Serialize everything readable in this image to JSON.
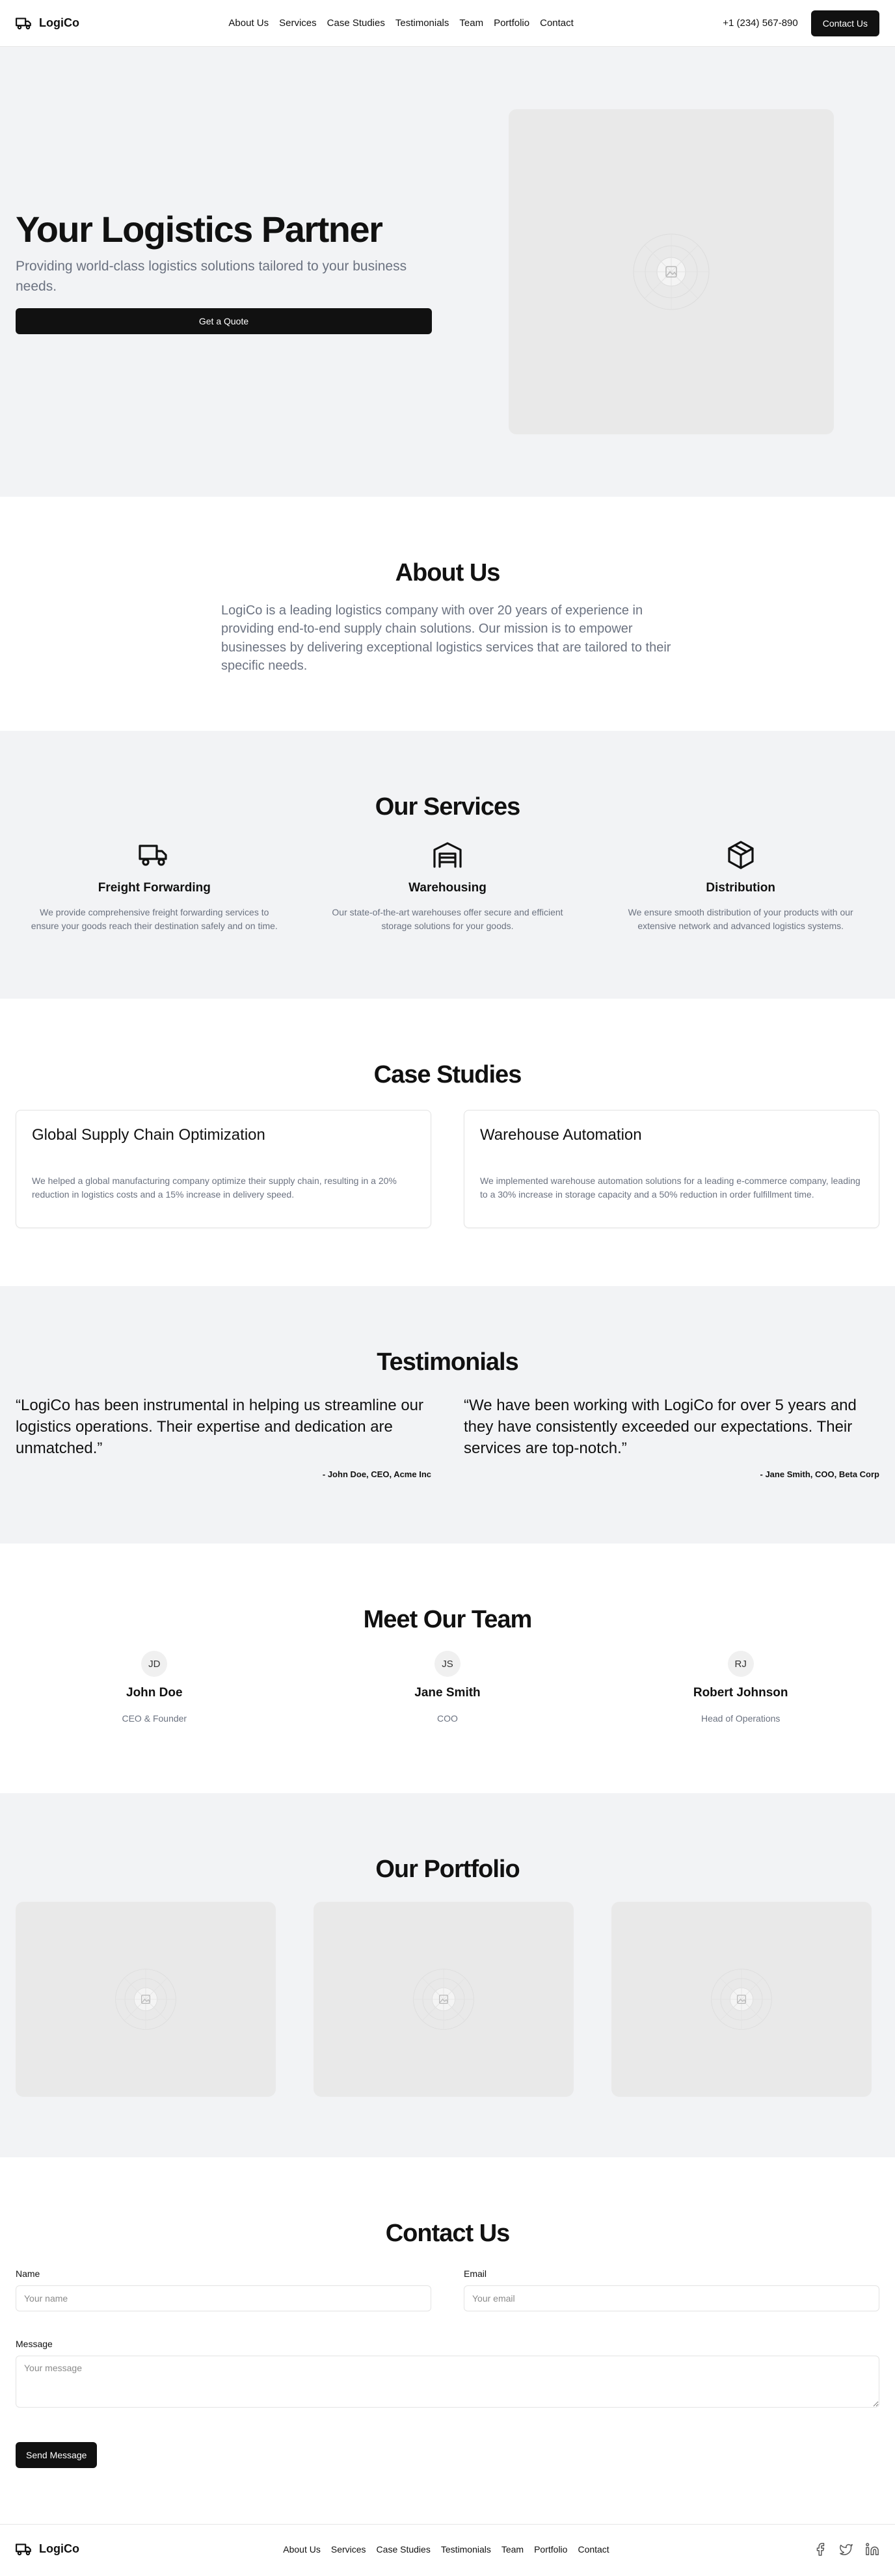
{
  "header": {
    "brand": "LogiCo",
    "nav": [
      "About Us",
      "Services",
      "Case Studies",
      "Testimonials",
      "Team",
      "Portfolio",
      "Contact"
    ],
    "phone": "+1 (234) 567-890",
    "contact_button": "Contact Us"
  },
  "hero": {
    "title": "Your Logistics Partner",
    "subtitle": "Providing world-class logistics solutions tailored to your business needs.",
    "cta": "Get a Quote"
  },
  "about": {
    "title": "About Us",
    "text": "LogiCo is a leading logistics company with over 20 years of experience in providing end-to-end supply chain solutions. Our mission is to empower businesses by delivering exceptional logistics services that are tailored to their specific needs."
  },
  "services": {
    "title": "Our Services",
    "items": [
      {
        "title": "Freight Forwarding",
        "text": "We provide comprehensive freight forwarding services to ensure your goods reach their destination safely and on time.",
        "icon": "truck-icon"
      },
      {
        "title": "Warehousing",
        "text": "Our state-of-the-art warehouses offer secure and efficient storage solutions for your goods.",
        "icon": "warehouse-icon"
      },
      {
        "title": "Distribution",
        "text": "We ensure smooth distribution of your products with our extensive network and advanced logistics systems.",
        "icon": "package-icon"
      }
    ]
  },
  "cases": {
    "title": "Case Studies",
    "items": [
      {
        "title": "Global Supply Chain Optimization",
        "text": "We helped a global manufacturing company optimize their supply chain, resulting in a 20% reduction in logistics costs and a 15% increase in delivery speed."
      },
      {
        "title": "Warehouse Automation",
        "text": "We implemented warehouse automation solutions for a leading e-commerce company, leading to a 30% increase in storage capacity and a 50% reduction in order fulfillment time."
      }
    ]
  },
  "testimonials": {
    "title": "Testimonials",
    "items": [
      {
        "quote": "“LogiCo has been instrumental in helping us streamline our logistics operations. Their expertise and dedication are unmatched.”",
        "author": "- John Doe, CEO, Acme Inc"
      },
      {
        "quote": "“We have been working with LogiCo for over 5 years and they have consistently exceeded our expectations. Their services are top-notch.”",
        "author": "- Jane Smith, COO, Beta Corp"
      }
    ]
  },
  "team": {
    "title": "Meet Our Team",
    "members": [
      {
        "initials": "JD",
        "name": "John Doe",
        "role": "CEO & Founder"
      },
      {
        "initials": "JS",
        "name": "Jane Smith",
        "role": "COO"
      },
      {
        "initials": "RJ",
        "name": "Robert Johnson",
        "role": "Head of Operations"
      }
    ]
  },
  "portfolio": {
    "title": "Our Portfolio"
  },
  "contact": {
    "title": "Contact Us",
    "name_label": "Name",
    "name_placeholder": "Your name",
    "email_label": "Email",
    "email_placeholder": "Your email",
    "message_label": "Message",
    "message_placeholder": "Your message",
    "submit": "Send Message"
  },
  "footer": {
    "brand": "LogiCo",
    "nav": [
      "About Us",
      "Services",
      "Case Studies",
      "Testimonials",
      "Team",
      "Portfolio",
      "Contact"
    ],
    "social": [
      "facebook-icon",
      "twitter-icon",
      "linkedin-icon"
    ]
  }
}
